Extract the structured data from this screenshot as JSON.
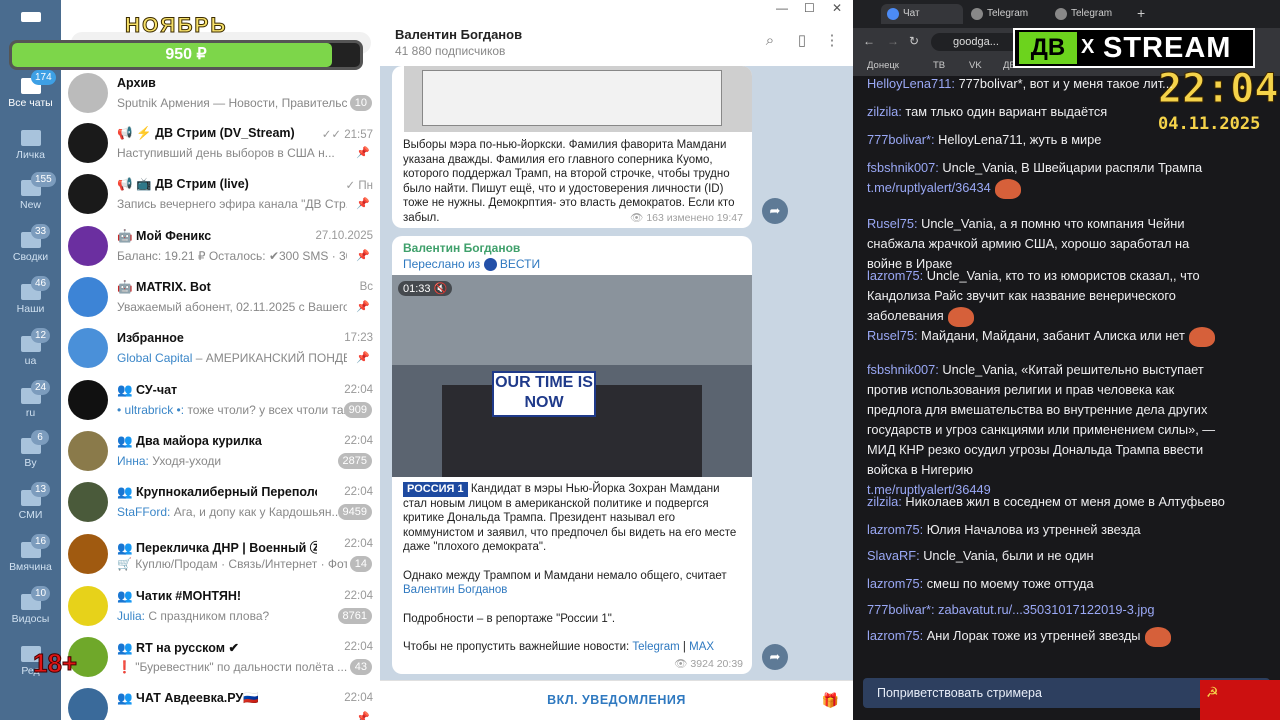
{
  "promo": {
    "month": "НОЯБРЬ",
    "amount": "950 ₽",
    "progress": 0.92,
    "age": "18+"
  },
  "rail": [
    {
      "label": "Все чаты",
      "count": "174",
      "active": true
    },
    {
      "label": "Личка",
      "count": ""
    },
    {
      "label": "New",
      "count": "155"
    },
    {
      "label": "Сводки",
      "count": "33"
    },
    {
      "label": "Наши",
      "count": "46"
    },
    {
      "label": "ua",
      "count": "12"
    },
    {
      "label": "ru",
      "count": "24"
    },
    {
      "label": "By",
      "count": "6"
    },
    {
      "label": "СМИ",
      "count": "13"
    },
    {
      "label": "Вмячина",
      "count": "16"
    },
    {
      "label": "Видосы",
      "count": "10"
    },
    {
      "label": "Ред",
      "count": ""
    }
  ],
  "chats": [
    {
      "name": "Архив",
      "sender": "",
      "preview": "Sputnik Армения — Новости, Правительс...",
      "time": "",
      "badge": "10",
      "color": "#bbbbbb"
    },
    {
      "name": "📢 ⚡ ДВ Стрим (DV_Stream)",
      "sender": "",
      "preview": "Наступивший день выборов в США н...",
      "time": "✓✓ 21:57",
      "badge": "",
      "color": "#1a1a1a"
    },
    {
      "name": "📢 📺 ДВ Стрим (live)",
      "sender": "",
      "preview": "Запись вечернего эфира канала \"ДВ Стр...",
      "time": "✓ Пн",
      "badge": "",
      "color": "#1a1a1a"
    },
    {
      "name": "🤖 Мой Феникс",
      "sender": "",
      "preview": "Баланс: 19.21 ₽ Осталось: ✔300 SMS · 300 ...",
      "time": "27.10.2025",
      "badge": "",
      "color": "#6b2fa0"
    },
    {
      "name": "🤖 MATRIX. Bot",
      "sender": "",
      "preview": "Уважаемый абонент, 02.11.2025 с Вашего а...",
      "time": "Вс",
      "badge": "",
      "color": "#3d84d6"
    },
    {
      "name": "Избранное",
      "sender": "Global Capital",
      "preview": "– АМЕРИКАНСКИЙ ПОНДЕЛ...",
      "time": "17:23",
      "badge": "",
      "color": "#4a90d9"
    },
    {
      "name": "👥 СУ-чат",
      "sender": "• ultrabrick •:",
      "preview": "тоже чтоли? у всех чтоли так?",
      "time": "22:04",
      "badge": "909",
      "color": "#111111"
    },
    {
      "name": "👥 Два майора курилка",
      "sender": "Инна:",
      "preview": "Уходя-уходи",
      "time": "22:04",
      "badge": "2875",
      "color": "#8a7a4a"
    },
    {
      "name": "👥 Крупнокалиберный Переполох Чат",
      "sender": "StaFFord:",
      "preview": "Ага, и допу как у Кардошьян...",
      "time": "22:04",
      "badge": "9459",
      "color": "#4a5a3a"
    },
    {
      "name": "👥 Перекличка ДНР | Военный Ⓩ Доне...",
      "sender": "",
      "preview": "🛒 Куплю/Продам · Связь/Интернет · Фотография",
      "time": "22:04",
      "badge": "14",
      "color": "#a05a10"
    },
    {
      "name": "👥 Чатик #МОНТЯН!",
      "sender": "Julia:",
      "preview": "С праздником плова?",
      "time": "22:04",
      "badge": "8761",
      "color": "#e7d21a"
    },
    {
      "name": "👥 RT на русском ✔",
      "sender": "",
      "preview": "❗ \"Буревестник\" по дальности полёта ...",
      "time": "22:04",
      "badge": "43",
      "color": "#6fa82a"
    },
    {
      "name": "👥 ЧАТ Авдеевка.РУ🇷🇺",
      "sender": "",
      "preview": "",
      "time": "22:04",
      "badge": "",
      "color": "#3a6a9a"
    }
  ],
  "channel": {
    "title": "Валентин Богданов",
    "subscribers": "41 880 подписчиков",
    "post1": {
      "text": "Выборы мэра по-нью-йоркски. Фамилия фаворита Мамдани указана дважды. Фамилия его главного соперника Куомо, которого поддержал Трамп, на второй строчке, чтобы трудно было найти. Пишут ещё, что и удостоверения личности (ID) тоже не нужны. Демокрптия- это власть демократов. Если кто забыл.",
      "views": "👁 163",
      "edited": "изменено 19:47"
    },
    "post2": {
      "author": "Валентин Богданов",
      "forwarded": "Переслано из",
      "source": "ВЕСТИ",
      "duration": "01:33",
      "banner": "OUR TIME IS NOW",
      "tag": "РОССИЯ 1",
      "p1": "Кандидат в мэры Нью-Йорка Зохран Мамдани стал новым лицом в американской политике и подвергся критике Дональда Трампа. Президент называл его коммунистом и заявил, что предпочел бы видеть на его месте даже \"плохого демократа\".",
      "p2": "Однако между Трампом и Мамдани немало общего, считает",
      "p2link": "Валентин Богданов",
      "p3": "Подробности – в репортаже \"России 1\".",
      "p4": "Чтобы не пропустить важнейшие новости:",
      "l1": "Telegram",
      "sep": "|",
      "l2": "MAX",
      "views": "👁 3924",
      "time": "20:39"
    },
    "notify": "ВКЛ. УВЕДОМЛЕНИЯ"
  },
  "browser": {
    "tabs": [
      "Чат",
      "Telegram",
      "Telegram"
    ],
    "url": "goodga...",
    "bookmarks": [
      "Донецк",
      "ТВ",
      "VK",
      "ДВ"
    ],
    "logo_left": "ДВ",
    "logo_x": "X",
    "logo_right": "STREAM",
    "clock": "22:04",
    "date": "04.11.2025",
    "greet": "Поприветствовать стримера"
  },
  "messages": [
    {
      "user": "HelloyLena711:",
      "text": "777bolivar*, вот и у меня такое лит..."
    },
    {
      "user": "zilzila:",
      "text": "там тлько один вариант выдаётся"
    },
    {
      "user": "777bolivar*:",
      "text": "HelloyLena711, жуть в мире"
    },
    {
      "user": "fsbshnik007:",
      "text": "Uncle_Vania, В Швейцарии распяли Трампа",
      "link": "t.me/ruptlyalert/36434"
    },
    {
      "user": "Rusel75:",
      "text": "Uncle_Vania, а я помню что компания Чейни снабжала жрачкой армию США, хорошо заработал на войне в Ираке"
    },
    {
      "user": "lazrom75:",
      "text": "Uncle_Vania, кто то из юмористов сказал,, что Кандолиза Райс звучит как название венерического заболевания"
    },
    {
      "user": "Rusel75:",
      "text": "Майдани, Майдани, забанит Алиска или нет"
    },
    {
      "user": "fsbshnik007:",
      "text": "Uncle_Vania, «Китай решительно выступает против использования религии и прав человека как предлога для вмешательства во внутренние дела других государств и угроз санкциями или применением силы», — МИД КНР резко осудил угрозы Дональда Трампа ввести войска в Нигерию",
      "link": "t.me/ruptlyalert/36449"
    },
    {
      "user": "zilzila:",
      "text": "Николаев жил в соседнем от меня доме в Алтуфьево"
    },
    {
      "user": "lazrom75:",
      "text": "Юлия Началова из утренней звезда"
    },
    {
      "user": "SlavaRF:",
      "text": "Uncle_Vania, были и не один"
    },
    {
      "user": "lazrom75:",
      "text": "смеш по моему тоже оттуда"
    },
    {
      "user": "777bolivar*:",
      "text": "",
      "link": "zabavatut.ru/...35031017122019-3.jpg"
    },
    {
      "user": "lazrom75:",
      "text": "Ани Лорак тоже из утренней звезды"
    }
  ]
}
